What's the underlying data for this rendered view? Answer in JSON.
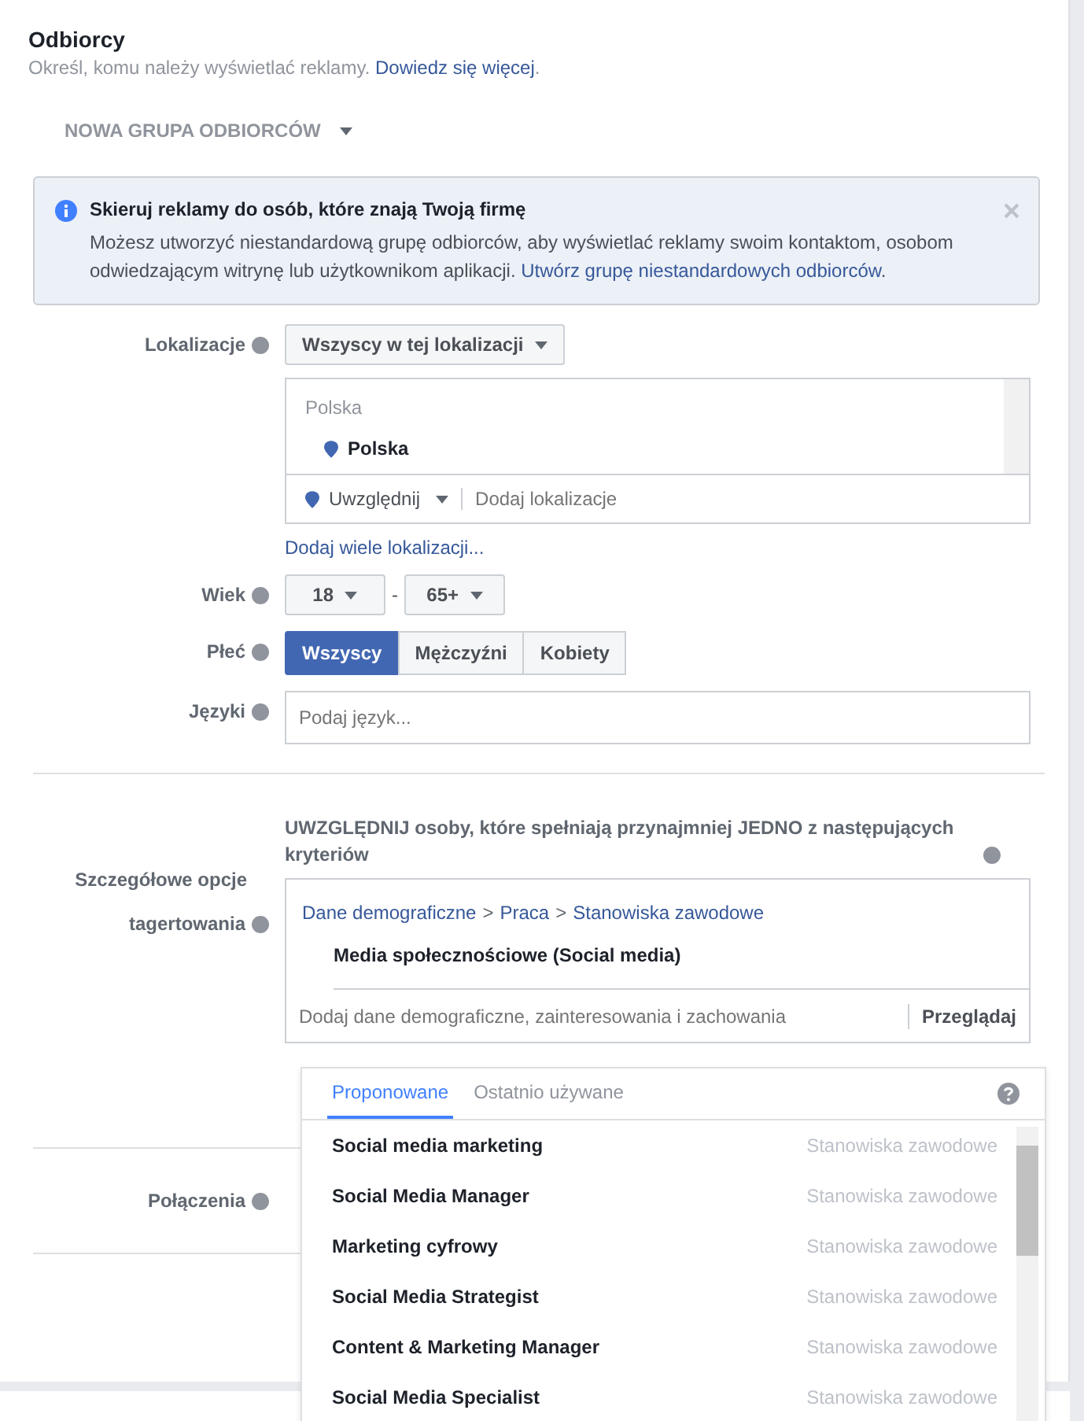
{
  "header": {
    "title": "Odbiorcy",
    "subtitle": "Określ, komu należy wyświetlać reklamy.",
    "link": "Dowiedz się więcej",
    "suffix": "."
  },
  "audience_menu": {
    "label": "NOWA GRUPA ODBIORCÓW"
  },
  "notice": {
    "title": "Skieruj reklamy do osób, które znają Twoją firmę",
    "text": "Możesz utworzyć niestandardową grupę odbiorców, aby wyświetlać reklamy swoim kontaktom, osobom odwiedzającym witrynę lub użytkownikom aplikacji.",
    "link": "Utwórz grupę niestandardowych odbiorców",
    "suffix": "."
  },
  "location": {
    "label": "Lokalizacje",
    "mode": "Wszyscy w tej lokalizacji",
    "group": "Polska",
    "items": [
      "Polska"
    ],
    "include": "Uwzględnij",
    "placeholder": "Dodaj lokalizacje",
    "link": "Dodaj wiele lokalizacji..."
  },
  "age": {
    "label": "Wiek",
    "min": "18",
    "separator": "-",
    "max": "65+"
  },
  "gender": {
    "label": "Płeć",
    "options": [
      {
        "label": "Wszyscy",
        "selected": true
      },
      {
        "label": "Mężczyźni",
        "selected": false
      },
      {
        "label": "Kobiety",
        "selected": false
      }
    ]
  },
  "languages": {
    "label": "Języki",
    "placeholder": "Podaj język..."
  },
  "detailed_targeting": {
    "label_lines": [
      "Szczegółowe opcje",
      "tagertowania"
    ],
    "heading": "UWZGLĘDNIJ osoby, które spełniają przynajmniej JEDNO z następujących kryteriów",
    "breadcrumb": [
      "Dane demograficzne",
      "Praca",
      "Stanowiska zawodowe"
    ],
    "breadcrumb_separator": ">",
    "item": "Media społecznościowe (Social media)",
    "placeholder": "Dodaj dane demograficzne, zainteresowania i zachowania",
    "browse": "Przeglądaj"
  },
  "connections": {
    "label": "Połączenia"
  },
  "suggestions": {
    "tabs": [
      {
        "label": "Proponowane",
        "selected": true
      },
      {
        "label": "Ostatnio używane",
        "selected": false
      }
    ],
    "items": [
      {
        "name": "Social media marketing",
        "category": "Stanowiska zawodowe"
      },
      {
        "name": "Social Media Manager",
        "category": "Stanowiska zawodowe"
      },
      {
        "name": "Marketing cyfrowy",
        "category": "Stanowiska zawodowe"
      },
      {
        "name": "Social Media Strategist",
        "category": "Stanowiska zawodowe"
      },
      {
        "name": "Content & Marketing Manager",
        "category": "Stanowiska zawodowe"
      },
      {
        "name": "Social Media Specialist",
        "category": "Stanowiska zawodowe"
      }
    ]
  }
}
